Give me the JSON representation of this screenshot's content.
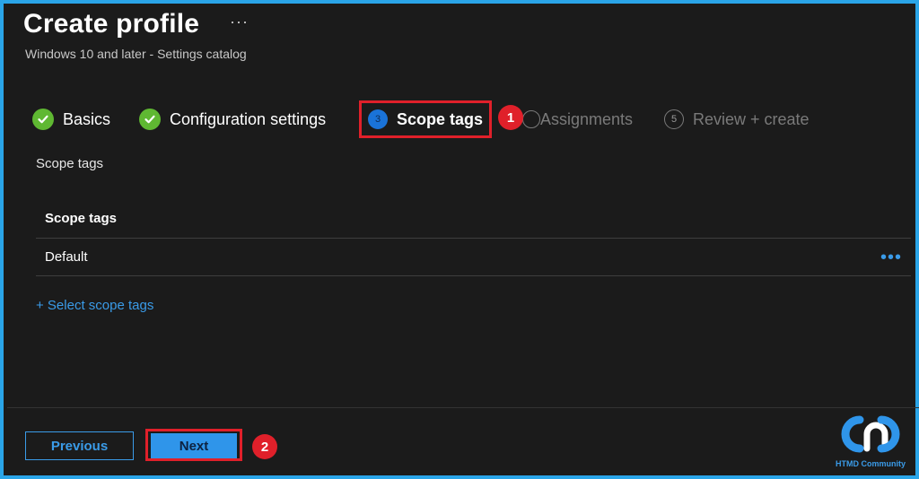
{
  "header": {
    "title": "Create profile",
    "more": "···",
    "subtitle": "Windows 10 and later - Settings catalog"
  },
  "steps": [
    {
      "label": "Basics",
      "state": "done"
    },
    {
      "label": "Configuration settings",
      "state": "done"
    },
    {
      "number": "3",
      "label": "Scope tags",
      "state": "current"
    },
    {
      "label": "Assignments",
      "state": "future"
    },
    {
      "number": "5",
      "label": "Review + create",
      "state": "future"
    }
  ],
  "annotations": {
    "badge1": "1",
    "badge2": "2"
  },
  "section": {
    "label": "Scope tags"
  },
  "table": {
    "header": "Scope tags",
    "rows": [
      {
        "value": "Default",
        "more": "•••"
      }
    ]
  },
  "select_link": "+ Select scope tags",
  "footer": {
    "previous_label": "Previous",
    "next_label": "Next"
  },
  "logo": {
    "text": "HTMD Community"
  },
  "colors": {
    "accent": "#2f95ea",
    "link": "#3a9be8",
    "success": "#5fb832",
    "highlight": "#e0202a",
    "background": "#1b1b1b"
  }
}
